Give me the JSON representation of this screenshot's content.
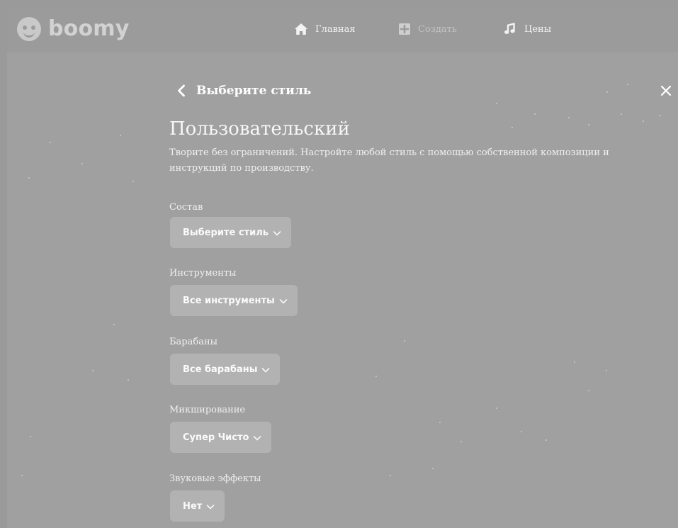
{
  "brand": {
    "name": "boomy",
    "logo_icon": "smiley-logo-icon"
  },
  "nav": {
    "items": [
      {
        "id": "home",
        "label": "Главная",
        "icon": "home-icon",
        "enabled": true
      },
      {
        "id": "create",
        "label": "Создать",
        "icon": "plus-square-icon",
        "enabled": false
      },
      {
        "id": "pricing",
        "label": "Цены",
        "icon": "music-note-icon",
        "enabled": true
      }
    ]
  },
  "page": {
    "back_title": "Выберите стиль",
    "section_title": "Пользовательский",
    "description": "Творите без ограничений. Настройте любой стиль с помощью собственной композиции и инструкций по производству."
  },
  "fields": [
    {
      "label": "Состав",
      "value": "Выберите стиль"
    },
    {
      "label": "Инструменты",
      "value": "Все инструменты"
    },
    {
      "label": "Барабаны",
      "value": "Все барабаны"
    },
    {
      "label": "Микширование",
      "value": "Супер Чисто"
    },
    {
      "label": "Звуковые эффекты",
      "value": "Нет"
    }
  ],
  "colors": {
    "background": "#9a9a9a",
    "panel": "#a0a0a0",
    "select_bg": "#b2b2b2",
    "text": "#f1f1f1"
  }
}
